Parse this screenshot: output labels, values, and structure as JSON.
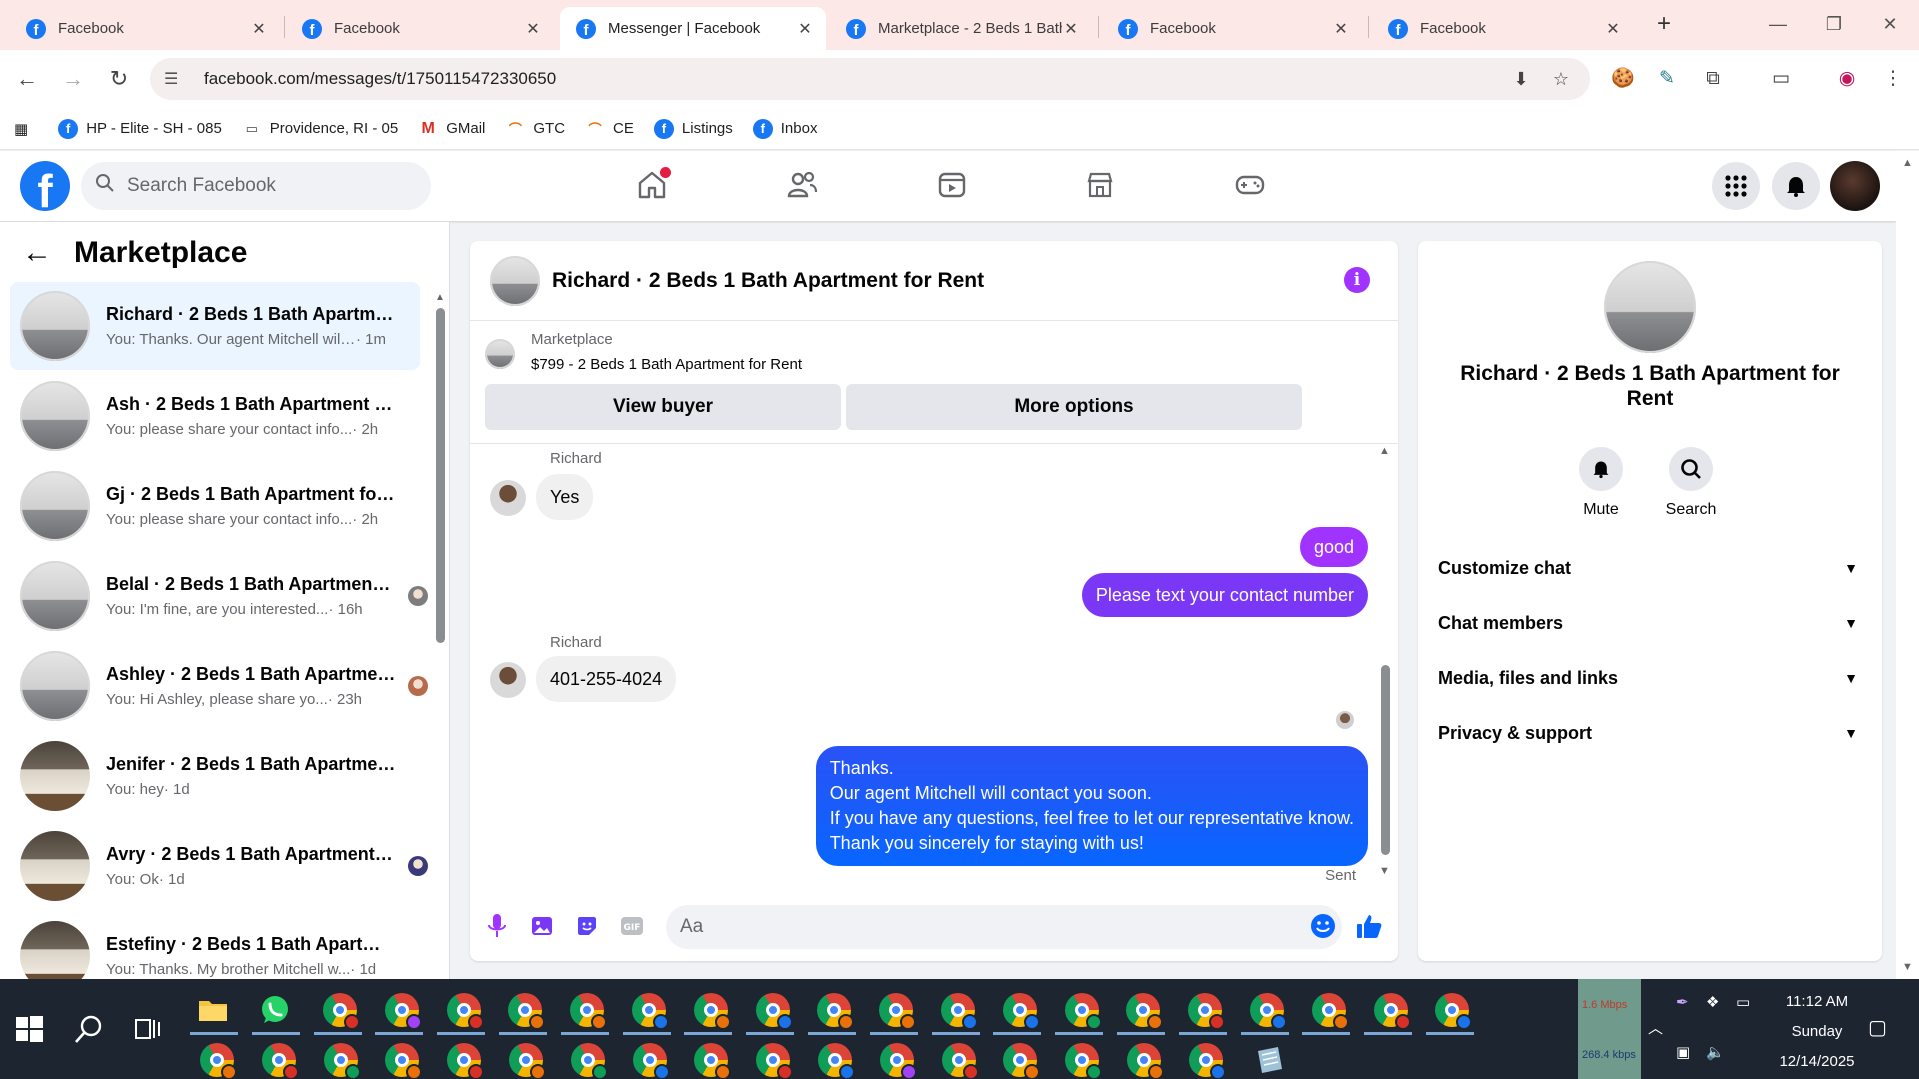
{
  "browser": {
    "tabs": [
      {
        "title": "Facebook"
      },
      {
        "title": "Facebook"
      },
      {
        "title": "Messenger | Facebook",
        "active": true
      },
      {
        "title": "Marketplace - 2 Beds 1 Bath"
      },
      {
        "title": "Facebook"
      },
      {
        "title": "Facebook"
      }
    ],
    "url": "facebook.com/messages/t/1750115472330650",
    "bookmarks": [
      {
        "label": "HP - Elite - SH - 085",
        "icon": "facebook-icon"
      },
      {
        "label": "Providence, RI - 05",
        "icon": "folder-icon"
      },
      {
        "label": "GMail",
        "icon": "gmail-icon"
      },
      {
        "label": "GTC",
        "icon": "rainbow-icon"
      },
      {
        "label": "CE",
        "icon": "rainbow-icon"
      },
      {
        "label": "Listings",
        "icon": "facebook-icon"
      },
      {
        "label": "Inbox",
        "icon": "facebook-icon"
      }
    ]
  },
  "facebook": {
    "search_placeholder": "Search Facebook",
    "brand_color": "#1877f2"
  },
  "sidebar": {
    "title": "Marketplace",
    "conversations": [
      {
        "name": "Richard · 2 Beds 1 Bath Apartment for Rent",
        "preview": "You: Thanks. Our agent Mitchell will contact you soon.",
        "time": " · 1m",
        "thumb": "apartment",
        "active": true
      },
      {
        "name": "Ash · 2 Beds 1 Bath Apartment for Rent",
        "preview": "You: please share your contact info...",
        "time": " · 2h",
        "thumb": "apartment"
      },
      {
        "name": "Gj · 2 Beds 1 Bath Apartment for Rent",
        "preview": "You: please share your contact info...",
        "time": " · 2h",
        "thumb": "apartment"
      },
      {
        "name": "Belal · 2 Beds 1 Bath Apartment for Rent",
        "preview": "You: I'm fine, are you interested...",
        "time": " · 16h",
        "thumb": "apartment",
        "seen": "#7d7d7d"
      },
      {
        "name": "Ashley · 2 Beds 1 Bath Apartment for Rent",
        "preview": "You: Hi Ashley, please share yo...",
        "time": " · 23h",
        "thumb": "apartment",
        "seen": "#b86a4c"
      },
      {
        "name": "Jenifer · 2 Beds 1 Bath Apartment for Rent",
        "preview": "You: hey",
        "time": " · 1d",
        "thumb": "kitchen"
      },
      {
        "name": "Avry · 2 Beds 1 Bath Apartment for Rent",
        "preview": "You: Ok",
        "time": " · 1d",
        "thumb": "kitchen",
        "seen": "#3a3a7a"
      },
      {
        "name": "Estefiny · 2 Beds 1 Bath Apartment for Rent",
        "preview": "You: Thanks. My brother Mitchell w...",
        "time": " · 1d",
        "thumb": "kitchen"
      }
    ]
  },
  "chat": {
    "title": "Richard · 2 Beds 1 Bath Apartment for Rent",
    "listing_source": "Marketplace",
    "listing": "$799 - 2 Beds 1 Bath Apartment for Rent",
    "view_buyer_label": "View buyer",
    "more_options_label": "More options",
    "messages": {
      "m1_sender": "Richard",
      "m1_text": "Yes",
      "m2_text": "good",
      "m3_text": "Please text your contact number",
      "m4_sender": "Richard",
      "m4_text": "401-255-4024",
      "m5_lines": [
        "Thanks.",
        "Our agent Mitchell will contact you soon.",
        "If you have any questions, feel free to let our representative know.",
        "Thank you sincerely for staying with us!"
      ],
      "status": "Sent"
    },
    "composer_placeholder": "Aa",
    "out_gradient_top": "#a033ff",
    "out_gradient_bottom": "#0866ff"
  },
  "details": {
    "name": "Richard · 2 Beds 1 Bath Apartment for Rent",
    "mute_label": "Mute",
    "search_label": "Search",
    "sections": [
      {
        "label": "Customize chat"
      },
      {
        "label": "Chat members"
      },
      {
        "label": "Media, files and links"
      },
      {
        "label": "Privacy & support"
      }
    ]
  },
  "taskbar": {
    "net_up": "1.6 Mbps",
    "net_down": "268.4 kbps",
    "time": "11:12 AM",
    "day": "Sunday",
    "date": "12/14/2025"
  }
}
